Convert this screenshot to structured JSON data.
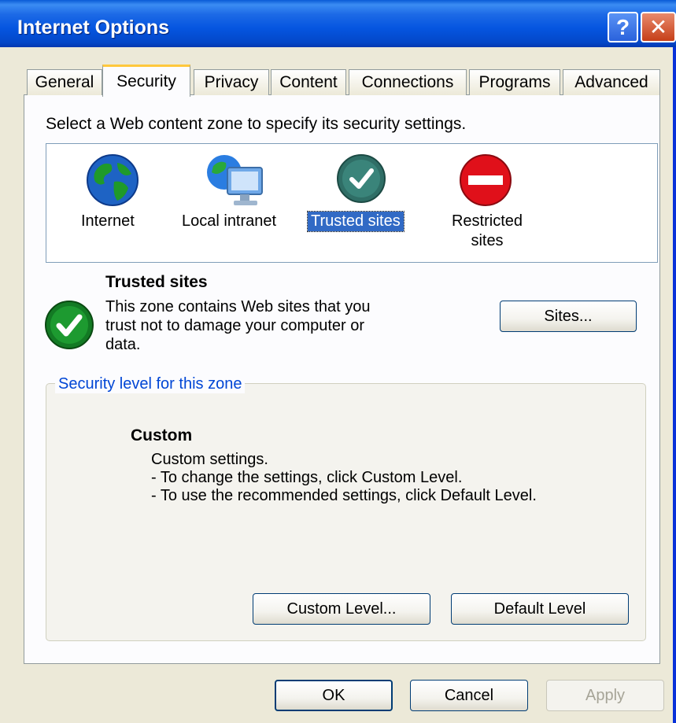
{
  "window": {
    "title": "Internet Options"
  },
  "tabs": [
    {
      "label": "General"
    },
    {
      "label": "Security"
    },
    {
      "label": "Privacy"
    },
    {
      "label": "Content"
    },
    {
      "label": "Connections"
    },
    {
      "label": "Programs"
    },
    {
      "label": "Advanced"
    }
  ],
  "active_tab": "Security",
  "instruction": "Select a Web content zone to specify its security settings.",
  "zones": [
    {
      "label": "Internet",
      "icon": "globe-icon"
    },
    {
      "label": "Local intranet",
      "icon": "intranet-icon"
    },
    {
      "label": "Trusted sites",
      "icon": "checkmark-icon",
      "selected": true
    },
    {
      "label": "Restricted",
      "label2": "sites",
      "icon": "restricted-icon"
    }
  ],
  "selected_zone": {
    "title": "Trusted sites",
    "description_lines": [
      "This zone contains Web sites that you",
      "trust not to damage your computer or",
      "data."
    ],
    "sites_button": "Sites..."
  },
  "security_level": {
    "legend": "Security level for this zone",
    "title": "Custom",
    "lines": [
      "Custom settings.",
      "- To change the settings, click Custom Level.",
      "- To use the recommended settings, click Default Level."
    ],
    "custom_level_button": "Custom Level...",
    "default_level_button": "Default Level"
  },
  "footer": {
    "ok": "OK",
    "cancel": "Cancel",
    "apply": "Apply"
  },
  "colors": {
    "titlebar": "#0555e0",
    "selection": "#316ac5",
    "group_legend": "#0046d5"
  }
}
